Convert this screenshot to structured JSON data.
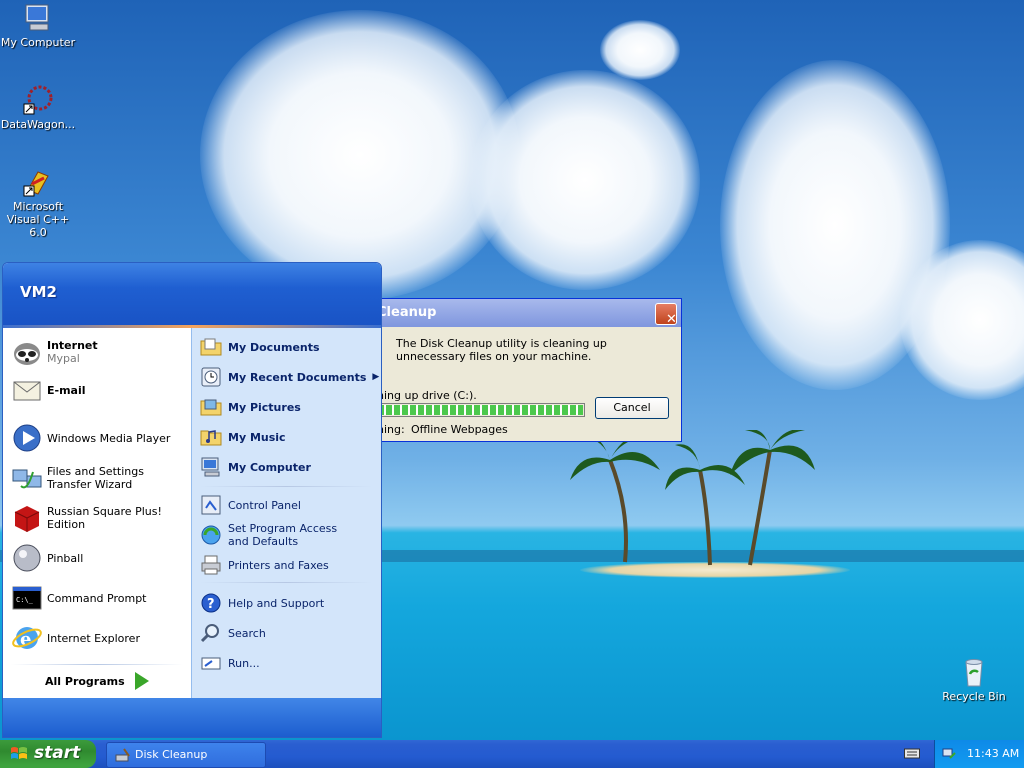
{
  "desktop": {
    "icons": [
      {
        "label": "My Computer"
      },
      {
        "label": "DataWagon..."
      },
      {
        "label": "Microsoft Visual C++ 6.0"
      },
      {
        "label": "Recycle Bin"
      }
    ]
  },
  "dialog": {
    "title": "Cleanup",
    "message": "The Disk Cleanup utility is cleaning up unnecessary files on your machine.",
    "status_label": "ning up drive  (C:).",
    "cleaning_label": "ning:",
    "cleaning_item": "Offline Webpages",
    "cancel_label": "Cancel",
    "close_glyph": "✕"
  },
  "start_menu": {
    "user": "VM2",
    "left_items": [
      {
        "label": "Internet",
        "sub": "Mypal",
        "icon": "raccoon-browser-icon"
      },
      {
        "label": "E-mail",
        "icon": "email-icon"
      },
      {
        "label": "Windows Media Player",
        "icon": "media-player-icon"
      },
      {
        "label": "Files and Settings Transfer Wizard",
        "icon": "transfer-wizard-icon"
      },
      {
        "label": "Russian Square Plus! Edition",
        "icon": "red-cube-icon"
      },
      {
        "label": "Pinball",
        "icon": "pinball-icon"
      },
      {
        "label": "Command Prompt",
        "icon": "command-prompt-icon"
      },
      {
        "label": "Internet Explorer",
        "icon": "internet-explorer-icon"
      }
    ],
    "all_programs": "All Programs",
    "right_items": [
      {
        "label": "My Documents",
        "icon": "documents-folder-icon"
      },
      {
        "label": "My Recent Documents",
        "icon": "recent-documents-icon"
      },
      {
        "label": "My Pictures",
        "icon": "pictures-folder-icon"
      },
      {
        "label": "My Music",
        "icon": "music-folder-icon"
      },
      {
        "label": "My Computer",
        "icon": "computer-icon"
      },
      {
        "label": "Control Panel",
        "icon": "control-panel-icon"
      },
      {
        "label": "Set Program Access and Defaults",
        "icon": "program-access-icon"
      },
      {
        "label": "Printers and Faxes",
        "icon": "printer-icon"
      },
      {
        "label": "Help and Support",
        "icon": "help-icon"
      },
      {
        "label": "Search",
        "icon": "search-icon"
      },
      {
        "label": "Run...",
        "icon": "run-icon"
      }
    ]
  },
  "taskbar": {
    "start_label": "start",
    "task_label": "Disk Cleanup",
    "clock": "11:43 AM"
  }
}
